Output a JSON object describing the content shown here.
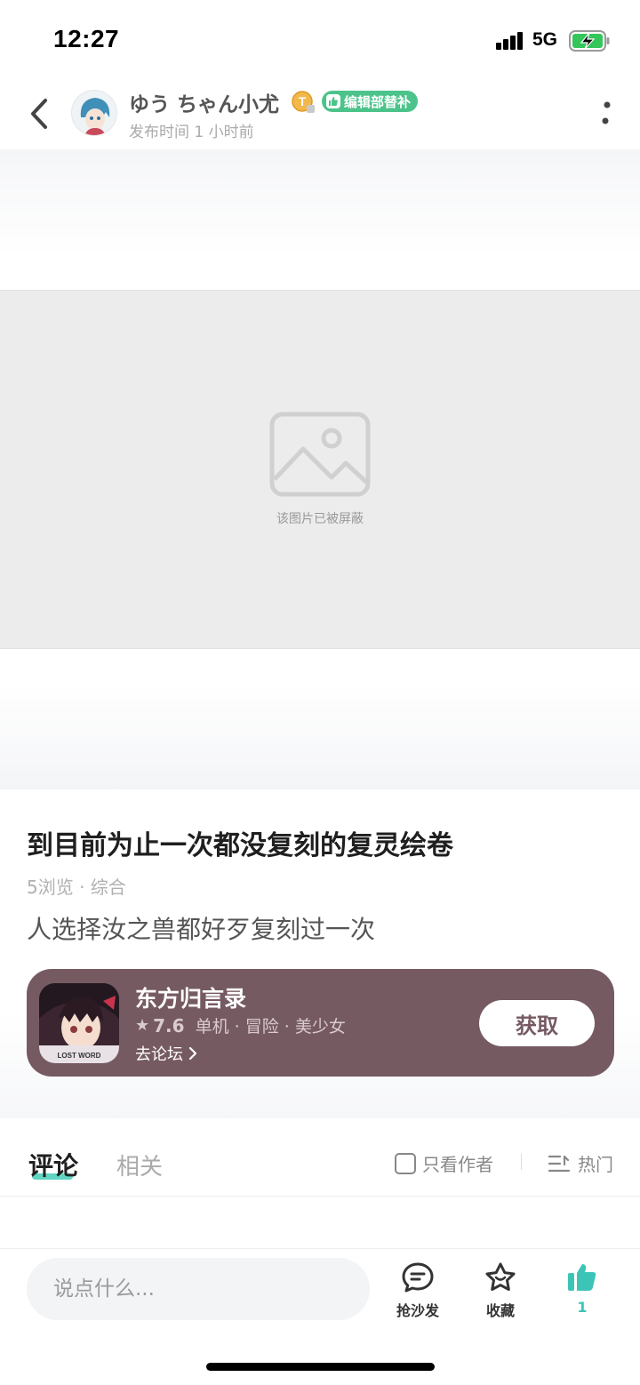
{
  "status_bar": {
    "time": "12:27",
    "network": "5G"
  },
  "header": {
    "user_name": "ゆう ちゃん小尤",
    "level_badge": "T",
    "role_badge": "编辑部替补",
    "post_time": "发布时间 1 小时前"
  },
  "media": {
    "blocked_text": "该图片已被屏蔽"
  },
  "post": {
    "title": "到目前为止一次都没复刻的复灵绘卷",
    "views": "5浏览",
    "category": "· 综合",
    "body": "人选择汝之兽都好歹复刻过一次"
  },
  "game_card": {
    "name": "东方归言录",
    "rating": "7.6",
    "tags": "单机 · 冒险 · 美少女",
    "forum_link": "去论坛",
    "get_label": "获取",
    "icon_text": "LOST WORD",
    "card_color": "#765a62"
  },
  "tabs": {
    "comments": "评论",
    "related": "相关",
    "author_only": "只看作者",
    "sort": "热门"
  },
  "bottom_bar": {
    "input_placeholder": "说点什么...",
    "sofa_label": "抢沙发",
    "favorite_label": "收藏",
    "like_count": "1"
  },
  "colors": {
    "accent_teal": "#3cc5b6",
    "badge_green": "#4cc38a"
  }
}
